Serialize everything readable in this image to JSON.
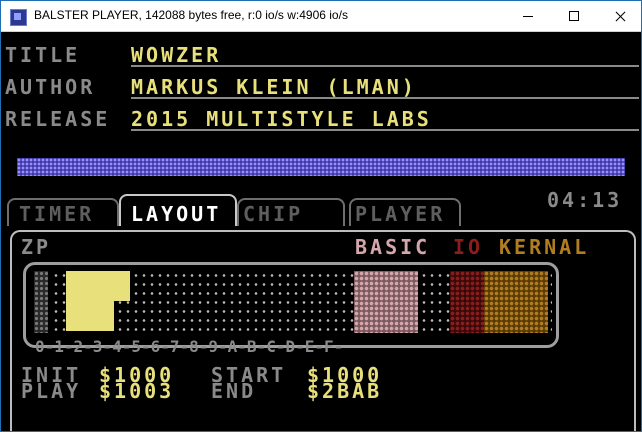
{
  "window": {
    "title": "BALSTER PLAYER, 142088 bytes free, r:0 io/s w:4906 io/s",
    "minimize_label": "minimize",
    "maximize_label": "maximize",
    "close_label": "close"
  },
  "info": {
    "title_label": "TITLE",
    "title_value": "WOWZER",
    "author_label": "AUTHOR",
    "author_value": "MARKUS KLEIN (LMAN)",
    "release_label": "RELEASE",
    "release_value": "2015 MULTISTYLE LABS"
  },
  "time": "04:13",
  "tabs": [
    {
      "label": "TIMER",
      "active": false
    },
    {
      "label": "LAYOUT",
      "active": true
    },
    {
      "label": "CHIP",
      "active": false
    },
    {
      "label": "PLAYER",
      "active": false
    }
  ],
  "layout": {
    "zp_label": "ZP",
    "basic_label": "BASIC",
    "io_label": "IO",
    "kernal_label": "KERNAL",
    "hex_axis": "0-1-2-3-4-5-6-7-8-9-A-B-C-D-E-F-",
    "colors": {
      "basic": "#d6a6ad",
      "io": "#8c1d1d",
      "kernal": "#b07d1f",
      "used": "#e8e07a"
    }
  },
  "addresses": {
    "init_label": "INIT",
    "init_value": "$1000",
    "play_label": "PLAY",
    "play_value": "$1003",
    "start_label": "START",
    "start_value": "$1000",
    "end_label": "END",
    "end_value": "$2BAB"
  }
}
